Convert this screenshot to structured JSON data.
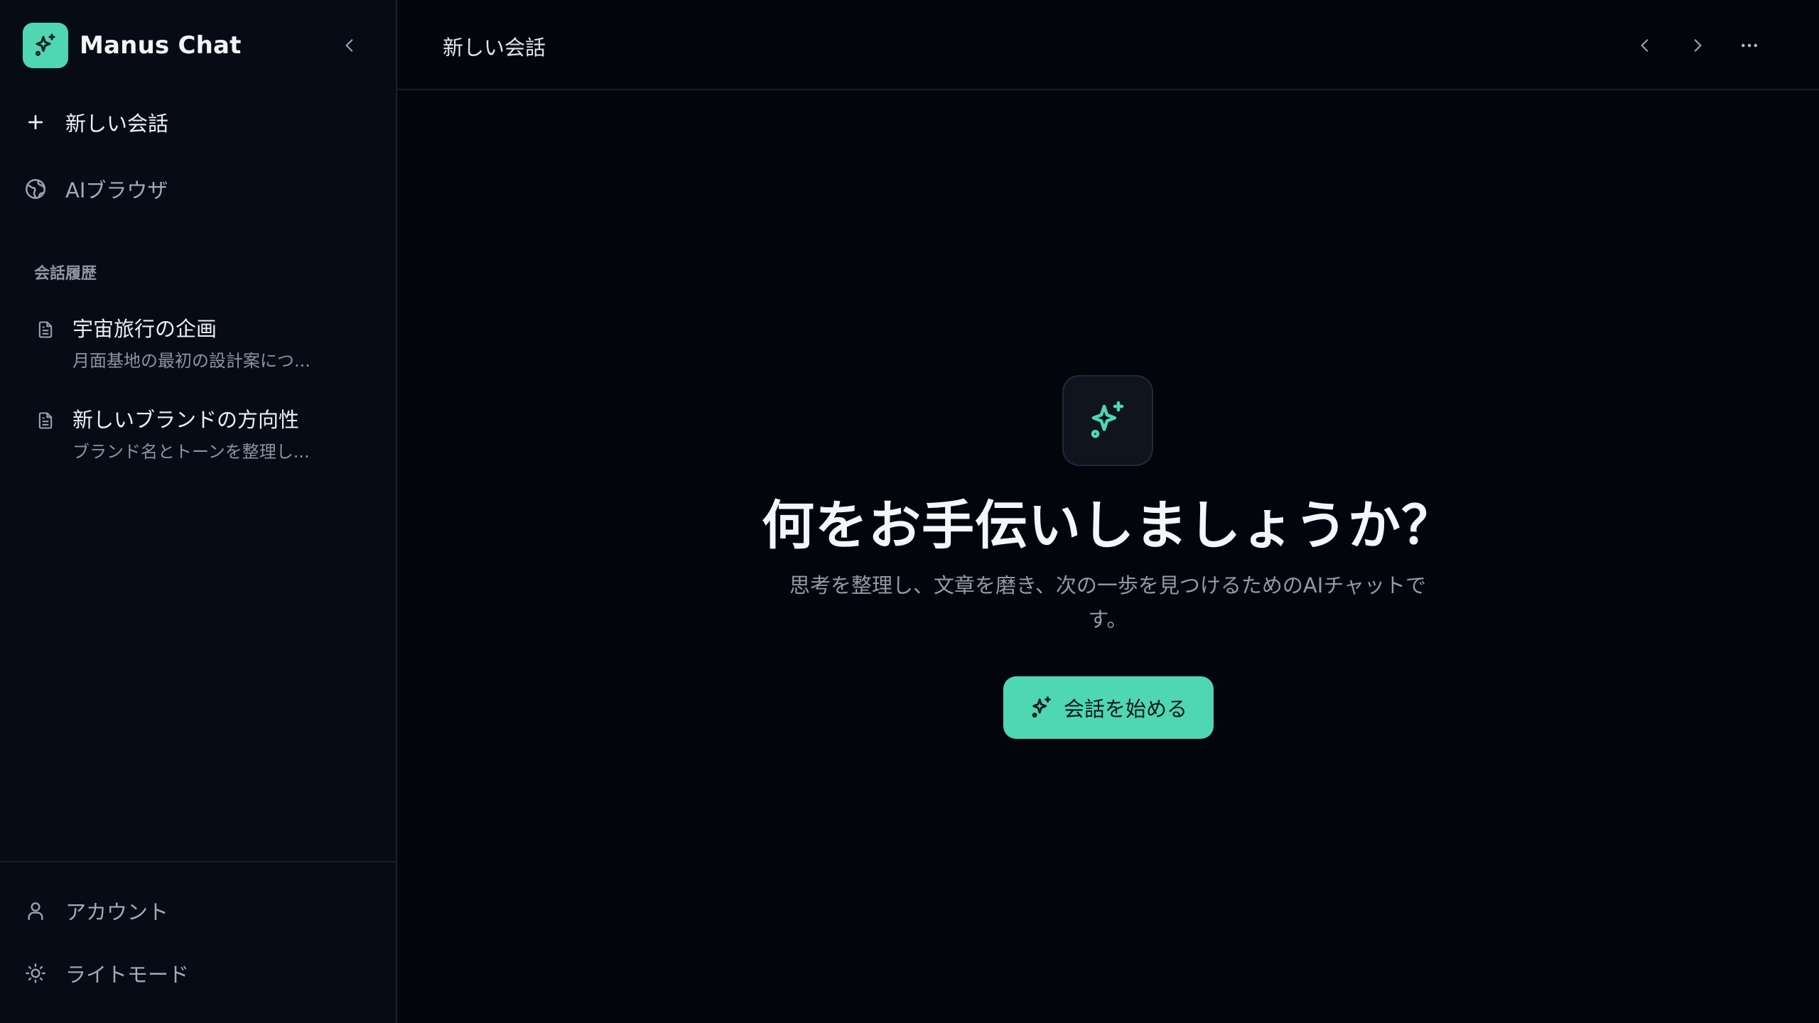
{
  "brand": {
    "name": "Manus Chat",
    "accent": "#4fd6b3"
  },
  "sidebar": {
    "new_chat_label": "新しい会話",
    "browser_label": "AIブラウザ",
    "history_heading": "会話履歴",
    "history": [
      {
        "title": "宇宙旅行の企画",
        "snippet": "月面基地の最初の設計案につ..."
      },
      {
        "title": "新しいブランドの方向性",
        "snippet": "ブランド名とトーンを整理し..."
      }
    ],
    "account_label": "アカウント",
    "theme_label": "ライトモード"
  },
  "topbar": {
    "title": "新しい会話"
  },
  "hero": {
    "title": "何をお手伝いしましょうか？",
    "subtitle": "思考を整理し、文章を磨き、次の一歩を見つけるためのAIチャットです。",
    "cta_label": "会話を始める"
  },
  "icons": {
    "logo": "sparkles-icon",
    "collapse": "chevron-left-icon",
    "new_chat": "plus-icon",
    "browser": "globe-icon",
    "history_item": "document-icon",
    "account": "user-icon",
    "theme": "sun-icon",
    "back": "chevron-left-icon",
    "forward": "chevron-right-icon",
    "more": "more-horizontal-icon"
  },
  "colors": {
    "background": "#03050d",
    "sidebar": "#070b15",
    "accent": "#4fd6b3"
  }
}
